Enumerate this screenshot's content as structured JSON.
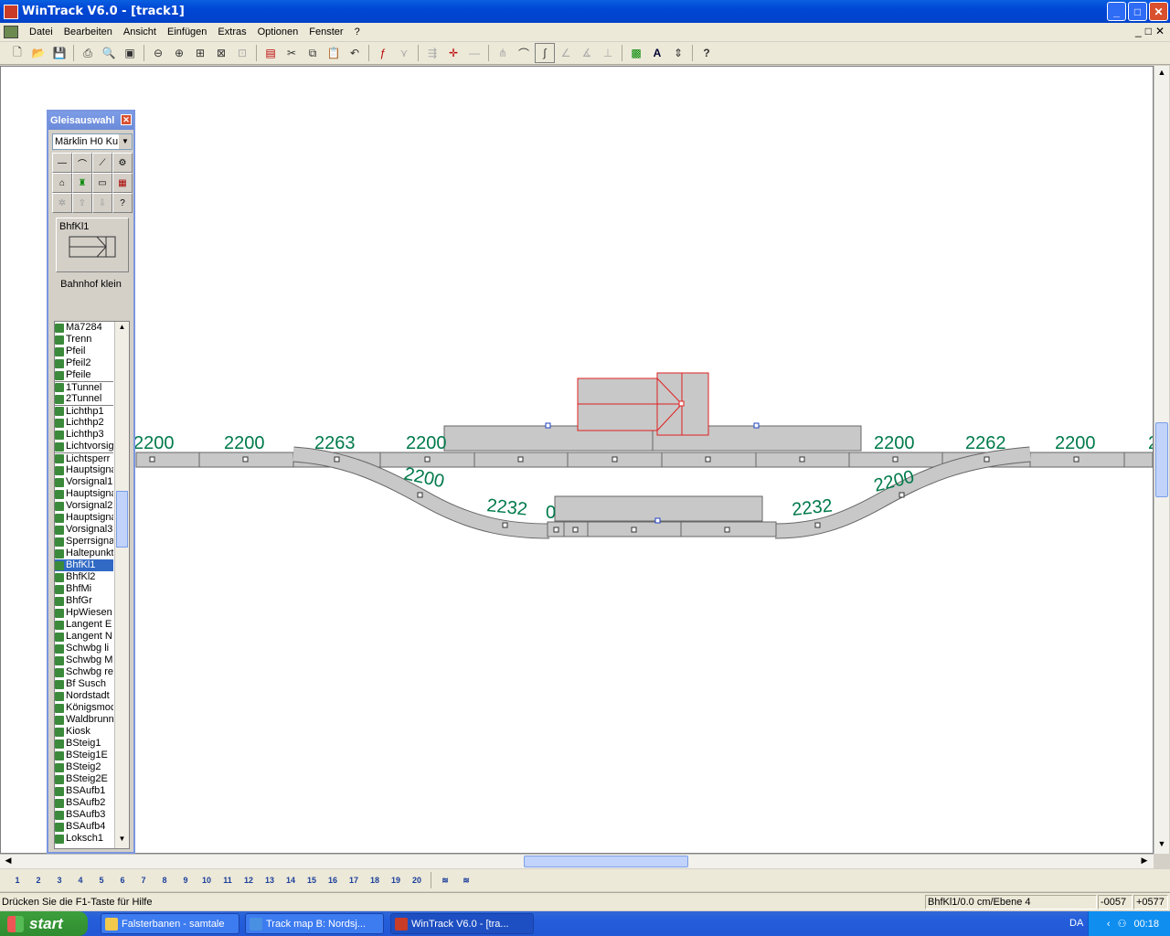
{
  "window": {
    "title": "WinTrack  V6.0 - [track1]",
    "buttons": {
      "minimize": "_",
      "maximize": "□",
      "close": "✕"
    }
  },
  "menu": {
    "items": [
      "Datei",
      "Bearbeiten",
      "Ansicht",
      "Einfügen",
      "Extras",
      "Optionen",
      "Fenster",
      "?"
    ],
    "mdi_controls": [
      "_",
      "□",
      "✕"
    ]
  },
  "toolbar": {
    "icons": [
      "new-icon",
      "open-icon",
      "save-icon",
      "print-icon",
      "print-preview-icon",
      "picture-icon",
      "zoom-out-icon",
      "zoom-in-icon",
      "zoom-window-icon",
      "zoom-all-icon",
      "zoom-disabled-icon",
      "component-list-icon",
      "cut-icon",
      "copy-icon",
      "paste-icon",
      "undo-icon",
      "measure-icon",
      "insert-disabled-icon",
      "align-disabled-icon",
      "move-icon",
      "line-disabled-icon",
      "flex-disabled-icon",
      "curve-icon",
      "draw-flex-icon",
      "flex-disabled-icon-2",
      "flex-disabled-icon-3",
      "signal-icon",
      "text-icon",
      "height-icon",
      "help-icon"
    ]
  },
  "palette": {
    "title": "Gleisauswahl",
    "close": "✕",
    "combo_value": "Märklin H0 Ku",
    "preview_label": "BhfKl1",
    "preview_description": "Bahnhof klein",
    "items": [
      "Mä7284",
      "Trenn",
      "Pfeil",
      "Pfeil2",
      "Pfeile",
      "1Tunnel",
      "2Tunnel",
      "Lichthp1",
      "Lichthp2",
      "Lichthp3",
      "Lichtvorsig",
      "Lichtsperr",
      "Hauptsigna",
      "Vorsignal1",
      "Hauptsigna",
      "Vorsignal2",
      "Hauptsigna",
      "Vorsignal3",
      "Sperrsigna",
      "Haltepunkt",
      "BhfKl1",
      "BhfKl2",
      "BhfMi",
      "BhfGr",
      "HpWiesen",
      "Langent E",
      "Langent N",
      "Schwbg li",
      "Schwbg M",
      "Schwbg re",
      "Bf Susch",
      "Nordstadt",
      "Königsmoc",
      "Waldbrunn",
      "Kiosk",
      "BSteig1",
      "BSteig1E",
      "BSteig2",
      "BSteig2E",
      "BSAufb1",
      "BSAufb2",
      "BSAufb3",
      "BSAufb4",
      "Loksch1"
    ],
    "selected_index": 20,
    "separator_indices": [
      5,
      7,
      11
    ]
  },
  "track_labels": {
    "top": [
      "2200",
      "2200",
      "2263",
      "2200",
      "2200",
      "2262",
      "2200",
      "2"
    ],
    "lower_left": [
      "2200",
      "2232",
      "0"
    ],
    "lower_right": [
      "2232",
      "2200"
    ]
  },
  "layers": {
    "labels": [
      "1",
      "2",
      "3",
      "4",
      "5",
      "6",
      "7",
      "8",
      "9",
      "10",
      "11",
      "12",
      "13",
      "14",
      "15",
      "16",
      "17",
      "18",
      "19",
      "20"
    ]
  },
  "status": {
    "help": "Drücken Sie die  F1-Taste für Hilfe",
    "info": "BhfKl1/0.0 cm/Ebene 4",
    "x": "-0057",
    "y": "+0577"
  },
  "taskbar": {
    "start": "start",
    "tasks": [
      "Falsterbanen - samtale",
      "Track map B: Nordsj...",
      "WinTrack  V6.0 - [tra..."
    ],
    "language": "DA",
    "clock": "00:18"
  },
  "colors": {
    "track_fill": "#c8c8c8",
    "track_label": "#007a4a",
    "selection": "#e02020",
    "title_blue": "#0046d5"
  }
}
